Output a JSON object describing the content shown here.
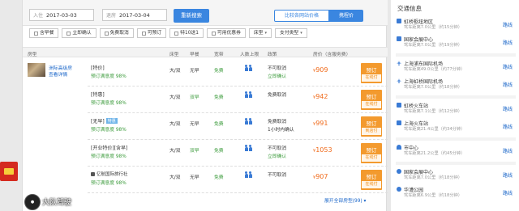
{
  "search": {
    "checkin_label": "入住",
    "checkin_date": "2017-03-03",
    "checkout_label": "退房",
    "checkout_date": "2017-03-04",
    "research_button": "重新搜索",
    "compare_button": "比较各网站价格",
    "price_button": "携程价"
  },
  "filters": [
    {
      "label": "含早餐",
      "type": "checkbox"
    },
    {
      "label": "立即确认",
      "type": "checkbox"
    },
    {
      "label": "免费取消",
      "type": "checkbox"
    },
    {
      "label": "可预订",
      "type": "checkbox"
    },
    {
      "label": "特10送1",
      "type": "checkbox"
    },
    {
      "label": "可用优惠券",
      "type": "checkbox"
    },
    {
      "label": "床型",
      "type": "dropdown"
    },
    {
      "label": "支付类型",
      "type": "dropdown"
    }
  ],
  "table_headers": {
    "room_type": "房型",
    "bed": "床型",
    "breakfast": "早餐",
    "wifi": "宽带",
    "people": "人数上限",
    "policy": "政策",
    "price": "房价（含服务费）"
  },
  "room": {
    "name": "洲际高级房",
    "detail": "查看详情"
  },
  "offers": [
    {
      "name": "[特价]",
      "tag": "",
      "satisfaction": "预订满意度 98%",
      "bed": "大/双",
      "breakfast": "无早",
      "wifi": "免费",
      "policy1": "不可取消",
      "policy2": "立即确认",
      "price": "909",
      "book": "预订",
      "pay": "在线付"
    },
    {
      "name": "[特惠]",
      "tag": "",
      "satisfaction": "预订满意度 98%",
      "bed": "大/双",
      "breakfast": "双早",
      "wifi": "免费",
      "policy1": "免费取消",
      "policy2": "",
      "price": "942",
      "book": "预订",
      "pay": "在线付"
    },
    {
      "name": "[无早]",
      "tag": "特惠",
      "satisfaction": "预订满意度 98%",
      "bed": "大/双",
      "breakfast": "无早",
      "wifi": "免费",
      "policy1": "免费取消",
      "policy2": "1小时内确认",
      "price": "991",
      "book": "预订",
      "pay": "到店付"
    },
    {
      "name": "[开业特价][含早]",
      "tag": "",
      "satisfaction": "预订满意度 98%",
      "bed": "大/双",
      "breakfast": "双早",
      "wifi": "免费",
      "policy1": "不可取消",
      "policy2": "立即确认",
      "price": "1053",
      "book": "预订",
      "pay": "在线付"
    },
    {
      "name": "亿航国际旅行社",
      "tag": "",
      "satisfaction": "预订满意度 98%",
      "bed": "大/双",
      "breakfast": "无早",
      "wifi": "免费",
      "policy1": "不可取消",
      "policy2": "",
      "price": "907",
      "book": "预订",
      "pay": "在线付"
    }
  ],
  "more_link": "展开全部房型(99)",
  "watermark": "大队驾驶",
  "traffic": {
    "title": "交通信息",
    "route_label": "路线",
    "items": [
      {
        "name": "虹桥枢纽地区",
        "dist": "驾车距离7.0公里（约15分钟）",
        "icon": "train-icon"
      },
      {
        "name": "国家会展中心",
        "dist": "驾车距离7.0公里（约19分钟）",
        "icon": "train-icon"
      },
      {
        "name": "上海浦东国际机场",
        "dist": "驾车距离49.0公里（约77分钟）",
        "icon": "plane-icon"
      },
      {
        "name": "上海虹桥国际机场",
        "dist": "驾车距离7.0公里（约18分钟）",
        "icon": "plane-icon"
      },
      {
        "name": "虹桥火车站",
        "dist": "驾车距离7.1公里（约12分钟）",
        "icon": "train-icon"
      },
      {
        "name": "上海火车站",
        "dist": "驾车距离21.4公里（约34分钟）",
        "icon": "train-icon"
      },
      {
        "name": "市中心",
        "dist": "驾车距离21.2公里（约45分钟）",
        "icon": "city-icon"
      },
      {
        "name": "国家会展中心",
        "dist": "驾车距离7.0公里（约18分钟）",
        "icon": "subway-icon"
      },
      {
        "name": "华漕公园",
        "dist": "驾车距离6.9公里（约18分钟）",
        "icon": "subway-icon"
      }
    ]
  }
}
